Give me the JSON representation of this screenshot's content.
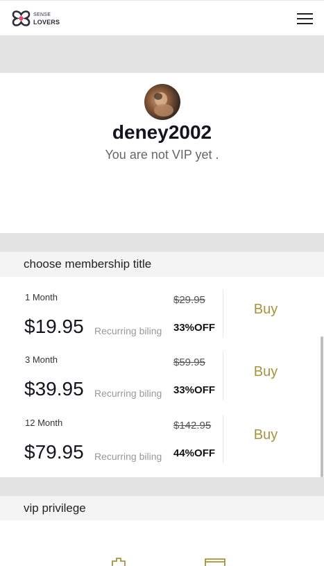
{
  "header": {
    "logo_line1": "SENSE",
    "logo_line2": "LOVERS",
    "brand_color": "#e84a6f",
    "menu_icon": "hamburger-menu-icon"
  },
  "profile": {
    "username": "deney2002",
    "vip_status": "You are not VIP yet ."
  },
  "membership": {
    "title": "choose membership title",
    "accent_color": "#a8923a",
    "plans": [
      {
        "term": "1 Month",
        "price": "$19.95",
        "recurring": "Recurring biling",
        "old_price": "$29.95",
        "discount": "33%OFF",
        "buy": "Buy"
      },
      {
        "term": "3 Month",
        "price": "$39.95",
        "recurring": "Recurring biling",
        "old_price": "$59.95",
        "discount": "33%OFF",
        "buy": "Buy"
      },
      {
        "term": "12 Month",
        "price": "$79.95",
        "recurring": "Recurring biling",
        "old_price": "$142.95",
        "discount": "44%OFF",
        "buy": "Buy"
      }
    ]
  },
  "vip": {
    "title": "vip privilege",
    "icons": [
      "privilege-icon",
      "privilege-icon"
    ]
  }
}
